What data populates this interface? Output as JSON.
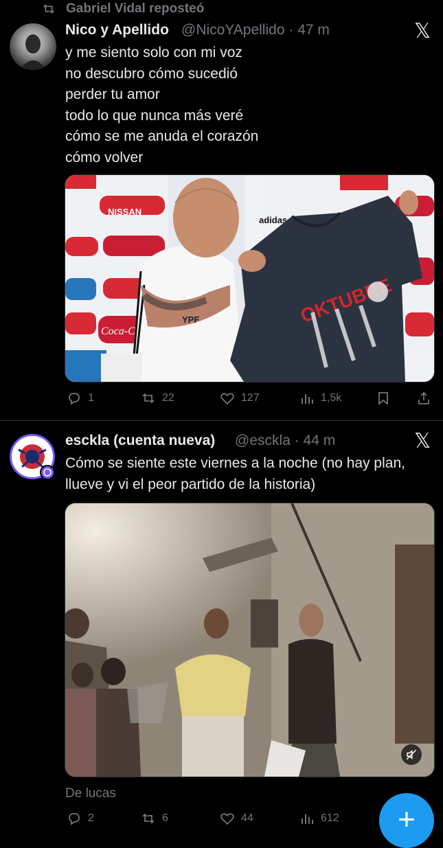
{
  "repost": {
    "label": "Gabriel Vidal reposteó"
  },
  "tweet1": {
    "name": "Nico y Apellido",
    "handle": "@NicoYApellido",
    "sep": "·",
    "time": "47 m",
    "text": "y me siento solo con mi voz\nno descubro cómo sucedió\nperder tu amor\ntodo lo que nunca más veré\ncómo se me anuda el corazón\ncómo volver",
    "image": {
      "shirt_text": "OKTUBRE",
      "sponsor_tags": [
        "NISSAN",
        "Coca-Cola",
        "adidas",
        "YPF"
      ]
    },
    "stats": {
      "replies": "1",
      "reposts": "22",
      "likes": "127",
      "views": "1,5k"
    }
  },
  "tweet2": {
    "name": "esckla (cuenta nueva)",
    "handle": "@esckla",
    "sep": "·",
    "time": "44 m",
    "text": "Cómo se siente este viernes a la noche (no hay plan, llueve y vi el peor partido de la historia)",
    "attribution": "De lucas",
    "stats": {
      "replies": "2",
      "reposts": "6",
      "likes": "44",
      "views": "612"
    }
  },
  "fab": {
    "label": "+"
  },
  "colors": {
    "background": "#000000",
    "text": "#e7e9ea",
    "muted": "#71767b",
    "accent": "#1d9bf0",
    "divider": "#2f3336"
  },
  "icons": [
    "repost-icon",
    "x-logo-icon",
    "reply-icon",
    "like-icon",
    "views-icon",
    "bookmark-icon",
    "share-icon",
    "mute-icon",
    "verified-badge-icon"
  ]
}
